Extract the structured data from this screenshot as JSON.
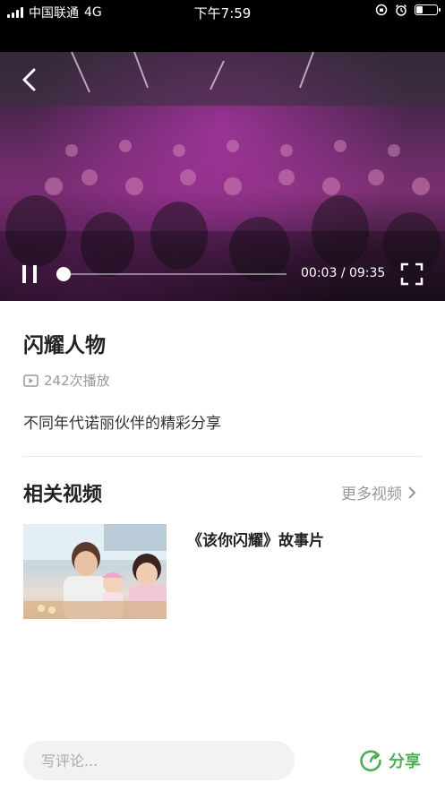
{
  "status_bar": {
    "carrier": "中国联通",
    "network": "4G",
    "time": "下午7:59",
    "battery_level": 0.35
  },
  "video": {
    "current_time": "00:03",
    "duration": "09:35",
    "progress": 0.005
  },
  "info": {
    "title": "闪耀人物",
    "play_count": "242次播放",
    "description": "不同年代诺丽伙伴的精彩分享"
  },
  "related": {
    "heading": "相关视频",
    "more_label": "更多视频",
    "items": [
      {
        "title": "《该你闪耀》故事片"
      }
    ]
  },
  "bottom_bar": {
    "comment_placeholder": "写评论...",
    "share_label": "分享"
  },
  "colors": {
    "accent_green": "#4caf50",
    "muted_gray": "#999999"
  }
}
